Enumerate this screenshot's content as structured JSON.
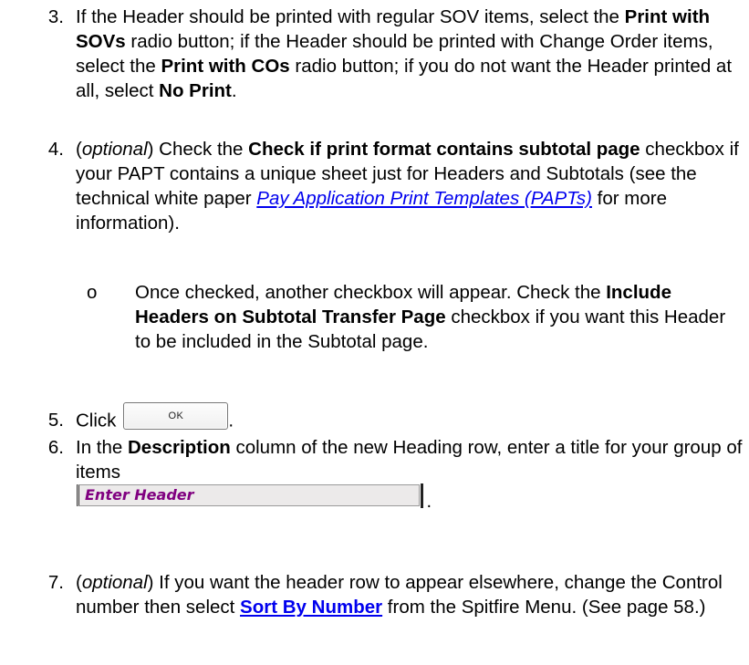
{
  "step3": {
    "number": "3.",
    "t1": "If the Header should be printed with regular SOV items, select the ",
    "b1": "Print with SOVs",
    "t2": " radio button; if the Header should be printed with Change Order items, select the ",
    "b2": "Print with COs",
    "t3": " radio button; if you do not want the Header printed at all, select ",
    "b3": "No Print",
    "t4": "."
  },
  "step4": {
    "number": "4.",
    "t0": "(",
    "i1": "optional",
    "t1": ") Check the ",
    "b1": "Check if print format contains subtotal page",
    "t2": " checkbox if your PAPT contains a unique sheet just for Headers and Subtotals (see the technical white paper ",
    "link": "Pay Application Print Templates (PAPTs)",
    "t3": " for more information).",
    "sub": {
      "bullet": "o",
      "t1": "Once checked, another checkbox will appear. Check the ",
      "b1": "Include Headers on Subtotal Transfer Page",
      "t2": " checkbox if you want this Header to be included in the Subtotal page."
    }
  },
  "step5": {
    "number": "5.",
    "text": "Click",
    "ok_label": "OK",
    "end": "."
  },
  "step6": {
    "number": "6.",
    "t1": "In the ",
    "b1": "Description",
    "t2": " column of the new Heading row, enter a title for your group of items",
    "field_text": "Enter Header",
    "end": "."
  },
  "step7": {
    "number": "7.",
    "t0": "(",
    "i1": "optional",
    "t1": ") If you want the header row to appear elsewhere, change the Control number then select ",
    "link": "Sort By Number",
    "t2": " from the Spitfire Menu.  (See page 58.)"
  }
}
